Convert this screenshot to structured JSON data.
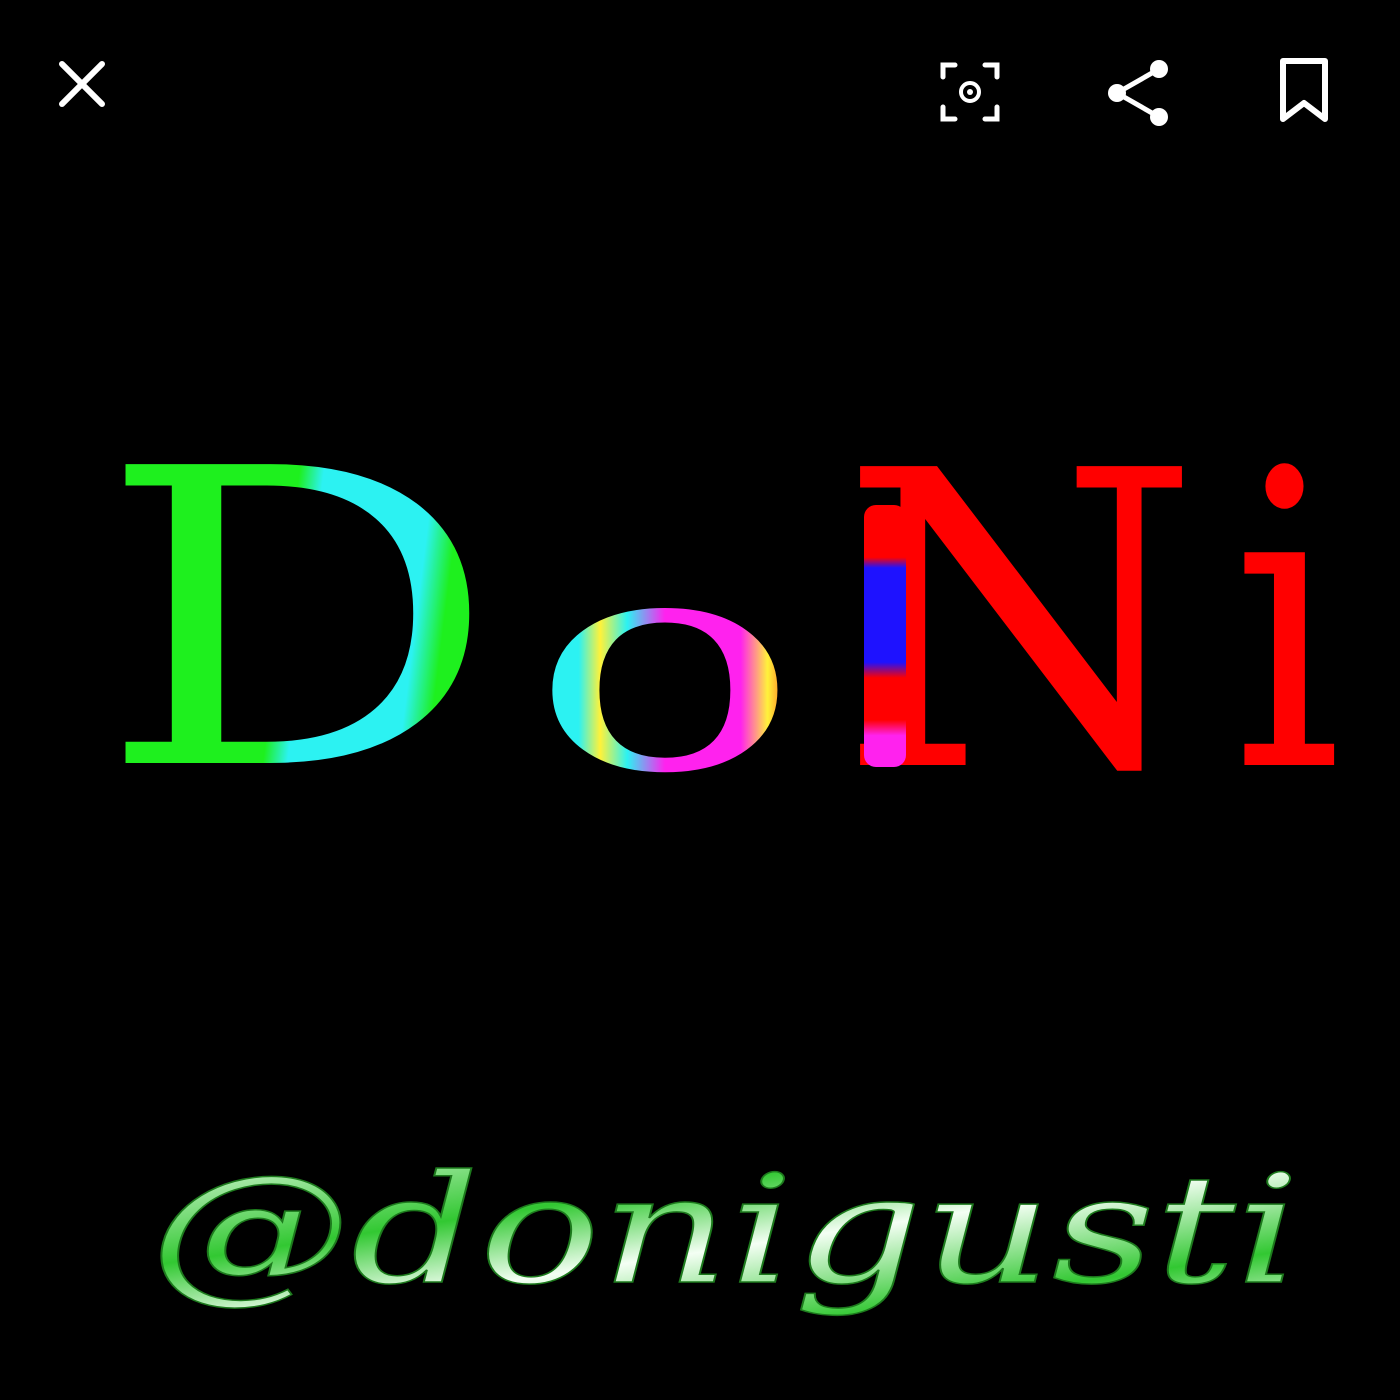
{
  "toolbar": {
    "close_icon": "close-icon",
    "lens_icon": "lens-search-icon",
    "share_icon": "share-icon",
    "bookmark_icon": "bookmark-icon"
  },
  "image": {
    "logo_letters": [
      "D",
      "o",
      "N",
      "i"
    ],
    "handle": "@donigusti"
  },
  "colors": {
    "background": "#000000",
    "icon": "#ffffff",
    "d_primary": "#1ef01e",
    "d_secondary": "#2cf2f2",
    "o_cyan": "#2cf2f2",
    "o_yellow": "#fff23a",
    "o_magenta": "#ff22ee",
    "o_red": "#ff1010",
    "n_red": "#ff0000",
    "n_blue": "#1e12ff",
    "n_magenta": "#ff22ee",
    "handle_green": "#32c832",
    "handle_white": "#f4fff4"
  }
}
